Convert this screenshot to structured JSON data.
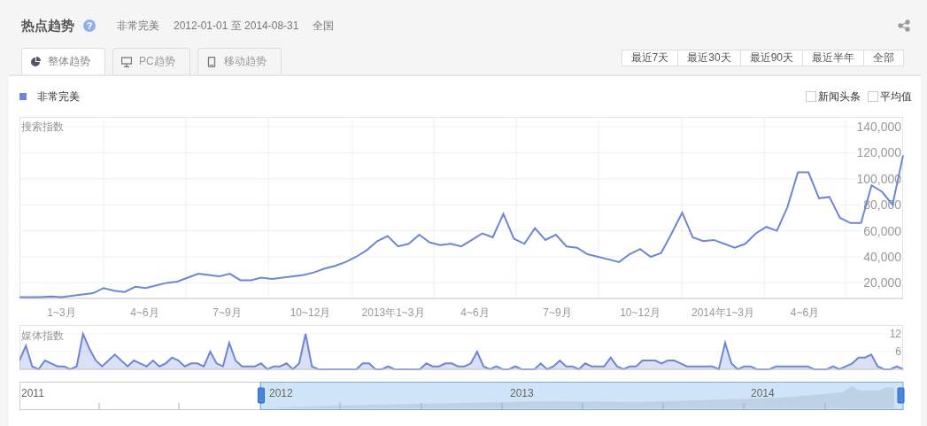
{
  "header": {
    "title": "热点趋势",
    "help_glyph": "?",
    "keyword": "非常完美",
    "date_range": "2012-01-01 至 2014-08-31",
    "region": "全国"
  },
  "tabs": [
    {
      "label": "整体趋势",
      "kind": "overall",
      "selected": true
    },
    {
      "label": "PC趋势",
      "kind": "pc",
      "selected": false
    },
    {
      "label": "移动趋势",
      "kind": "mobile",
      "selected": false
    }
  ],
  "range_buttons": [
    {
      "label": "最近7天",
      "selected": false
    },
    {
      "label": "最近30天",
      "selected": false
    },
    {
      "label": "最近90天",
      "selected": false
    },
    {
      "label": "最近半年",
      "selected": false
    },
    {
      "label": "全部",
      "selected": false
    }
  ],
  "options": [
    {
      "label": "新闻头条",
      "checked": false
    },
    {
      "label": "平均值",
      "checked": false
    }
  ],
  "search_chart": {
    "x_axis_labels": [
      "1~3月",
      "4~6月",
      "7~9月",
      "10~12月",
      "2013年1~3月",
      "4~6月",
      "7~9月",
      "10~12月",
      "2014年1~3月",
      "4~6月"
    ],
    "chart_data": {
      "type": "line",
      "grid": true,
      "ylabel": "搜索指数",
      "ylim": [
        8000,
        147500
      ],
      "yticks": [
        {
          "value": 20000,
          "label": "20,000"
        },
        {
          "value": 40000,
          "label": "40,000"
        },
        {
          "value": 60000,
          "label": "60,000"
        },
        {
          "value": 80000,
          "label": "80,000"
        },
        {
          "value": 100000,
          "label": "100,000"
        },
        {
          "value": 120000,
          "label": "120,000"
        },
        {
          "value": 140000,
          "label": "140,000"
        }
      ],
      "series": [
        {
          "name": "非常完美",
          "color": "#6e86d6",
          "values": [
            9000,
            9000,
            9000,
            9500,
            9000,
            10000,
            11000,
            12000,
            16000,
            14000,
            13000,
            17000,
            16000,
            18000,
            20000,
            21000,
            24000,
            27000,
            26000,
            25000,
            27000,
            22000,
            22000,
            24000,
            23000,
            24000,
            25000,
            26000,
            28000,
            31000,
            33000,
            36000,
            40000,
            45000,
            52000,
            56000,
            48000,
            50000,
            57000,
            51000,
            49000,
            50000,
            48000,
            53000,
            58000,
            55000,
            73000,
            54000,
            50000,
            62000,
            53000,
            57000,
            48000,
            47000,
            42000,
            40000,
            38000,
            36000,
            42000,
            46000,
            40000,
            43000,
            58000,
            74000,
            55000,
            52000,
            53000,
            50000,
            47000,
            50000,
            58000,
            63000,
            60000,
            78000,
            105000,
            105000,
            85000,
            86000,
            70000,
            66000,
            66000,
            95000,
            90000,
            80000,
            118000
          ]
        }
      ]
    }
  },
  "media_chart": {
    "chart_data": {
      "type": "area",
      "grid": true,
      "ylabel": "媒体指数",
      "ylim": [
        0,
        15
      ],
      "yticks": [
        {
          "value": 6,
          "label": "6"
        },
        {
          "value": 12,
          "label": "12"
        }
      ],
      "series": [
        {
          "color": "#6e86d6",
          "values": [
            3,
            8,
            1,
            0,
            3,
            2,
            1,
            1,
            0,
            1,
            12,
            7,
            3,
            1,
            3,
            5,
            3,
            1,
            3,
            2,
            1,
            3,
            1,
            2,
            4,
            3,
            1,
            2,
            2,
            1,
            6,
            2,
            1,
            9,
            3,
            1,
            1,
            1,
            2,
            0,
            1,
            1,
            2,
            0,
            2,
            12,
            1,
            0,
            0,
            0,
            0,
            0,
            0,
            0,
            2,
            2,
            0,
            0,
            1,
            0,
            0,
            0,
            0,
            0,
            2,
            1,
            1,
            2,
            2,
            1,
            1,
            2,
            6,
            1,
            0,
            1,
            0,
            0,
            1,
            0,
            0,
            0,
            2,
            0,
            1,
            3,
            1,
            1,
            0,
            2,
            1,
            1,
            1,
            4,
            1,
            0,
            1,
            1,
            3,
            3,
            3,
            2,
            3,
            3,
            2,
            1,
            1,
            1,
            1,
            1,
            0,
            9,
            2,
            0,
            1,
            1,
            0,
            0,
            0,
            1,
            1,
            1,
            1,
            1,
            1,
            0,
            0,
            0,
            1,
            0,
            1,
            2,
            4,
            4,
            5,
            1,
            0,
            0,
            1,
            0
          ]
        }
      ]
    }
  },
  "navigator": {
    "years": [
      "2011",
      "2012",
      "2013",
      "2014"
    ],
    "selection": {
      "level": 0.727
    }
  }
}
